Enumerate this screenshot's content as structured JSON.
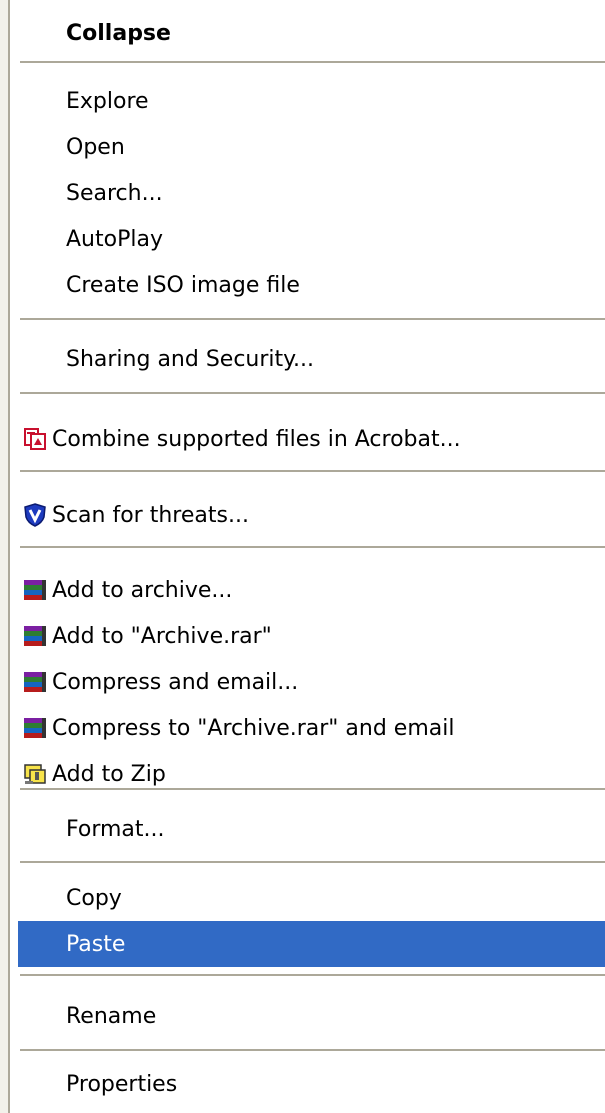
{
  "menu": {
    "items": {
      "collapse": "Collapse",
      "explore": "Explore",
      "open": "Open",
      "search": "Search...",
      "autoplay": "AutoPlay",
      "create_iso": "Create ISO image file",
      "sharing": "Sharing and Security...",
      "combine_acrobat": "Combine supported files in Acrobat...",
      "scan_threats": "Scan for threats...",
      "add_archive": "Add to archive...",
      "add_archive_rar": "Add to \"Archive.rar\"",
      "compress_email": "Compress and email...",
      "compress_rar_email": "Compress to \"Archive.rar\" and email",
      "add_zip": "Add to Zip",
      "format": "Format...",
      "copy": "Copy",
      "paste": "Paste",
      "rename": "Rename",
      "properties": "Properties"
    },
    "highlighted_item": "paste",
    "colors": {
      "highlight": "#316ac5",
      "separator": "#aca899"
    },
    "icons": {
      "combine_acrobat": "acrobat-combine-icon",
      "scan_threats": "shield-icon",
      "winrar": "winrar-books-icon",
      "add_zip": "zip-icon"
    }
  }
}
